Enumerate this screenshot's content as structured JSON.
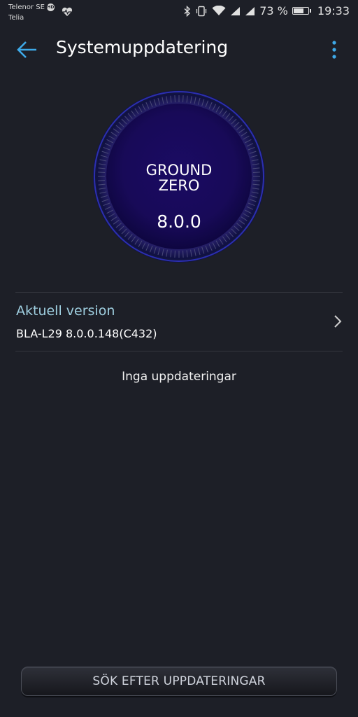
{
  "status_bar": {
    "carrier_1": "Telenor SE",
    "carrier_1_badge": "HD",
    "carrier_2": "Telia",
    "battery_percent_text": "73 %",
    "battery_level": 0.73,
    "time": "19:33",
    "icons": [
      "health-icon",
      "bluetooth-icon",
      "vibrate-icon",
      "wifi-icon",
      "signal-icon",
      "battery-icon"
    ]
  },
  "app_bar": {
    "title": "Systemuppdatering",
    "back_icon": "back-arrow-icon",
    "menu_icon": "more-vert-icon"
  },
  "dial": {
    "name": "GROUND\nZERO",
    "version": "8.0.0"
  },
  "current_version": {
    "label": "Aktuell version",
    "value": "BLA-L29 8.0.0.148(C432)"
  },
  "status_message": "Inga uppdateringar",
  "check_button": {
    "label": "SÖK EFTER UPPDATERINGAR"
  },
  "colors": {
    "background": "#1d1f27",
    "accent": "#3ea9e8",
    "label_accent": "#9fcfe0",
    "dial_core": "#1c0f6b"
  }
}
